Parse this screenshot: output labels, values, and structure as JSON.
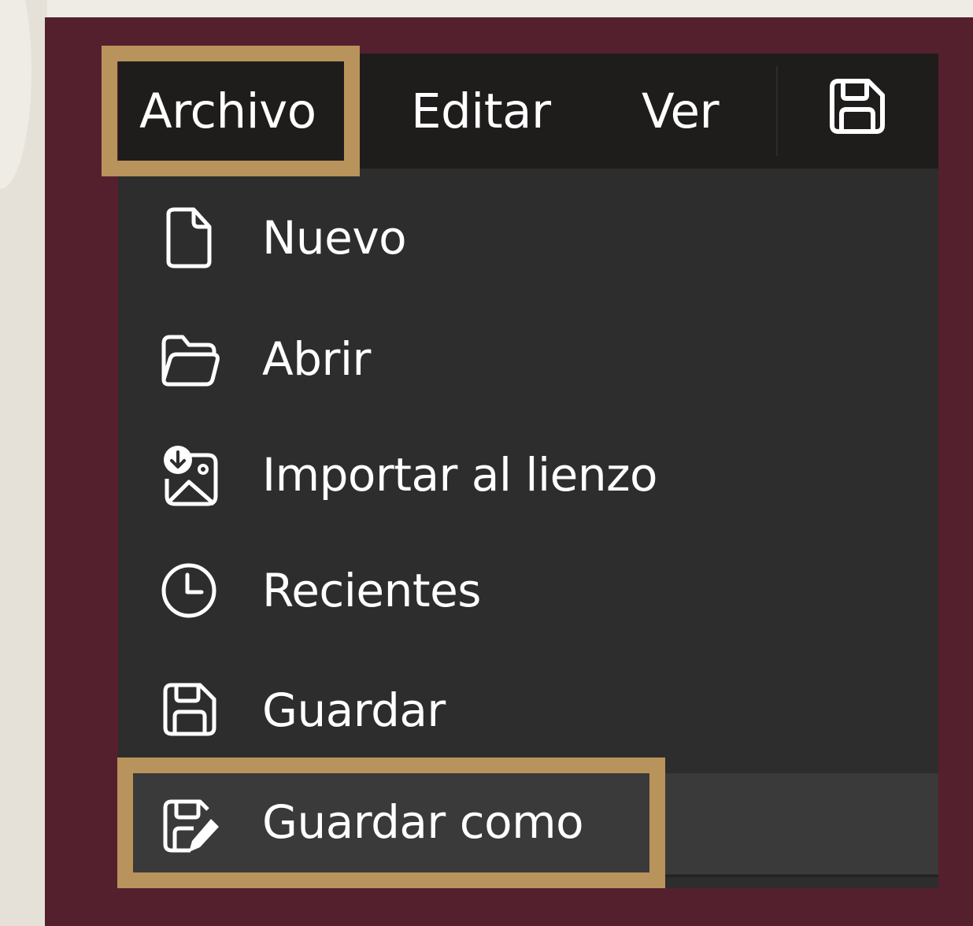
{
  "menubar": {
    "items": [
      {
        "label": "Archivo",
        "icon": null,
        "highlighted": true
      },
      {
        "label": "Editar",
        "icon": null
      },
      {
        "label": "Ver",
        "icon": null
      }
    ],
    "save_icon": "save-icon"
  },
  "file_menu": {
    "items": [
      {
        "label": "Nuevo",
        "icon": "new-file-icon"
      },
      {
        "label": "Abrir",
        "icon": "open-folder-icon"
      },
      {
        "label": "Importar al lienzo",
        "icon": "import-image-icon"
      },
      {
        "label": "Recientes",
        "icon": "clock-icon"
      },
      {
        "label": "Guardar",
        "icon": "save-icon"
      },
      {
        "label": "Guardar como",
        "icon": "save-as-icon",
        "highlighted": true,
        "selected": true
      }
    ]
  },
  "colors": {
    "frame": "#55202e",
    "menubar": "#1f1d1c",
    "menu": "#2d2d2d",
    "selected_item": "#3a3a3a",
    "highlight": "#b8935b",
    "text": "#ffffff"
  }
}
